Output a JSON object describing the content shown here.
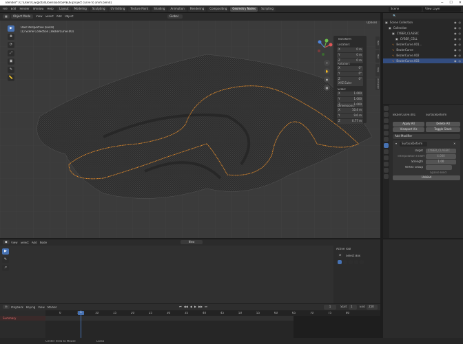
{
  "titlebar": {
    "text": "Blender* [C:\\Users\\Cwiglotal\\Downloads\\SPIEDE\\project curve to anim.blend]"
  },
  "menus": [
    "File",
    "Edit",
    "Render",
    "Window",
    "Help"
  ],
  "workspaces": [
    "Layout",
    "Modeling",
    "Sculpting",
    "UV Editing",
    "Texture Paint",
    "Shading",
    "Animation",
    "Rendering",
    "Compositing",
    "Geometry Nodes",
    "Scripting"
  ],
  "active_workspace": "Geometry Nodes",
  "scene": "Scene",
  "view_layer": "View Layer",
  "viewport": {
    "mode": "Object Mode",
    "menus": [
      "View",
      "Select",
      "Add",
      "Object"
    ],
    "transform_orientation": "Global",
    "info_line1": "User Perspective (Local)",
    "info_line2": "(1) Scene Collection | BezierCurve.001",
    "options": "Options",
    "tools": [
      "▶",
      "✥",
      "⟳",
      "⤢",
      "▣",
      "✎",
      "📏"
    ]
  },
  "npanel": {
    "transform": "Transform",
    "location": "Location:",
    "loc": [
      {
        "a": "X",
        "v": "0 m"
      },
      {
        "a": "Y",
        "v": "0 m"
      },
      {
        "a": "Z",
        "v": "0 m"
      }
    ],
    "rotation": "Rotation:",
    "rot": [
      {
        "a": "X",
        "v": "0°"
      },
      {
        "a": "Y",
        "v": "0°"
      },
      {
        "a": "Z",
        "v": "0°"
      }
    ],
    "euler": "XYZ Euler",
    "scale": "Scale:",
    "scl": [
      {
        "a": "X",
        "v": "1.000"
      },
      {
        "a": "Y",
        "v": "1.000"
      },
      {
        "a": "Z",
        "v": "1.000"
      }
    ],
    "dimensions": "Dimensions:",
    "dim": [
      {
        "a": "X",
        "v": "10.4 m"
      },
      {
        "a": "Y",
        "v": "9.6 m"
      },
      {
        "a": "Z",
        "v": "0.77 m"
      }
    ],
    "tabs": [
      "Item",
      "Tool",
      "View",
      "Animation"
    ]
  },
  "outliner": {
    "title": "Scene Collection",
    "rows": [
      {
        "name": "Scene Collection",
        "indent": 0,
        "sel": false
      },
      {
        "name": "Collection",
        "indent": 1,
        "sel": false
      },
      {
        "name": "CYBER_CLASSIC",
        "indent": 2,
        "sel": false
      },
      {
        "name": "CYBER_CELL",
        "indent": 3,
        "sel": false
      },
      {
        "name": "BezierCurve.001...",
        "indent": 2,
        "sel": false
      },
      {
        "name": "BezierCurve",
        "indent": 2,
        "sel": false
      },
      {
        "name": "BezierCurve.002",
        "indent": 2,
        "sel": false
      },
      {
        "name": "BezierCurve.003",
        "indent": 2,
        "sel": true
      }
    ]
  },
  "properties": {
    "object": "BezierCurve.001",
    "modifier": "SurfaceDeform",
    "apply_all": "Apply All",
    "delete_all": "Delete All",
    "viewport_vis": "Viewport Vis",
    "toggle_stack": "Toggle Stack",
    "add_modifier": "Add Modifier",
    "mod_name": "SurfaceDeform",
    "target_label": "Target",
    "target_value": "CYBER_CLASSIC",
    "interp_label": "Interpolation Falloff",
    "interp_value": "4.000",
    "strength_label": "Strength",
    "strength_value": "1.00",
    "vgroup_label": "Vertex Group",
    "sparse": "Sparse Bind",
    "unbind": "Unbind"
  },
  "toolpanel": {
    "menus": [
      "View",
      "Select",
      "Add",
      "Node"
    ],
    "new_label": "New",
    "active_tool": "Active Tool",
    "select_box": "Select Box"
  },
  "timeline": {
    "menus": [
      "Playback",
      "Keying",
      "View",
      "Marker"
    ],
    "current_frame": "1",
    "start_label": "Start",
    "start": "1",
    "end_label": "End",
    "end": "250",
    "summary": "Summary",
    "ticks": [
      "0",
      "5",
      "10",
      "15",
      "20",
      "25",
      "30",
      "35",
      "40",
      "45",
      "50",
      "55",
      "60",
      "65",
      "70",
      "75",
      "80"
    ]
  },
  "status": {
    "left": "Center View to Mouse",
    "mid": "Lasso"
  },
  "colors": {
    "accent": "#4772b3",
    "curve": "#e08a2c",
    "selected": "#334d80"
  }
}
